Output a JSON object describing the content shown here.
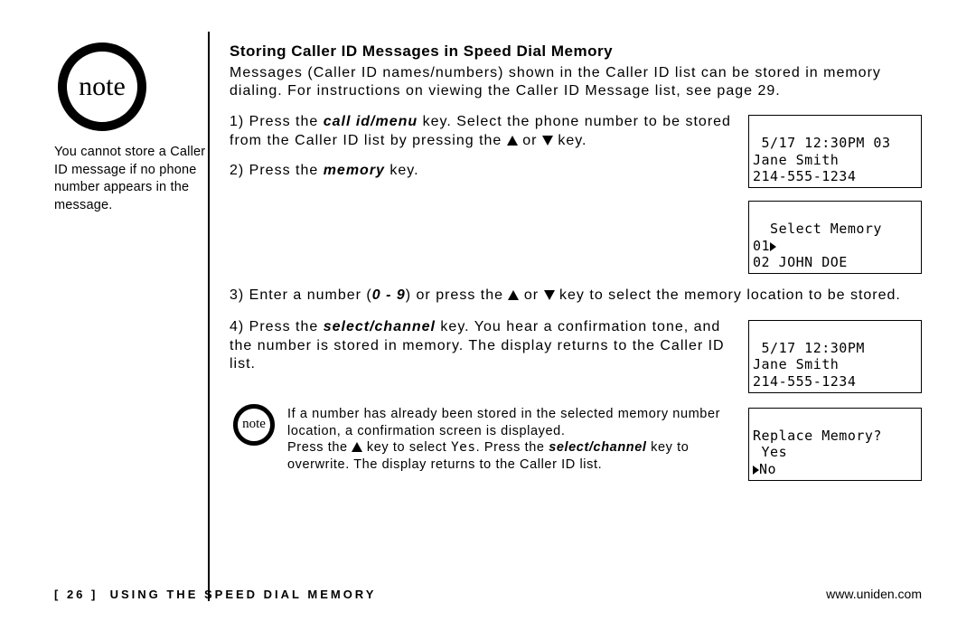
{
  "sidebar": {
    "note_label": "note",
    "text": "You cannot store a Caller ID message if no phone number appears in the message."
  },
  "main": {
    "heading": "Storing Caller ID Messages in Speed Dial Memory",
    "intro": "Messages (Caller ID names/numbers) shown in the Caller ID list can be stored in memory dialing. For instructions on viewing the Caller ID Message list, see page 29.",
    "step1_a": "1) Press the ",
    "step1_key": "call id/menu",
    "step1_b": " key. Select the phone number to be stored from the Caller ID list by pressing the ",
    "step1_c": " or ",
    "step1_d": " key.",
    "step2_a": "2) Press the ",
    "step2_key": "memory",
    "step2_b": " key.",
    "step3_a": "3) Enter a number (",
    "step3_range": "0 - 9",
    "step3_b": ") or press the ",
    "step3_c": " or ",
    "step3_d": " key to select the memory location to be stored.",
    "step4_a": "4) Press the ",
    "step4_key": "select/channel",
    "step4_b": " key. You hear a confirmation tone, and the number is stored in memory. The display returns to the Caller ID list.",
    "note2_label": "note",
    "note2_a": "If a number has already been stored in the selected memory number location, a confirmation screen is displayed.",
    "note2_b1": "Press the ",
    "note2_b2": " key to select ",
    "note2_yes": "Yes",
    "note2_b3": ". Press the ",
    "note2_key": "select/channel",
    "note2_b4": " key to overwrite. The display returns to the Caller ID list."
  },
  "lcd1": {
    "l1": " 5/17 12:30PM 03",
    "l2": "Jane Smith",
    "l3": "214-555-1234"
  },
  "lcd2": {
    "l1": "  Select Memory",
    "l2a": "01",
    "l3": "02 JOHN DOE"
  },
  "lcd3": {
    "l1": " 5/17 12:30PM",
    "l2": "Jane Smith",
    "l3": "214-555-1234"
  },
  "lcd4": {
    "l1": "Replace Memory?",
    "l2": " Yes",
    "l3": "No"
  },
  "footer": {
    "page": "[ 26 ]",
    "section": "USING THE SPEED DIAL MEMORY",
    "url": "www.uniden.com"
  }
}
